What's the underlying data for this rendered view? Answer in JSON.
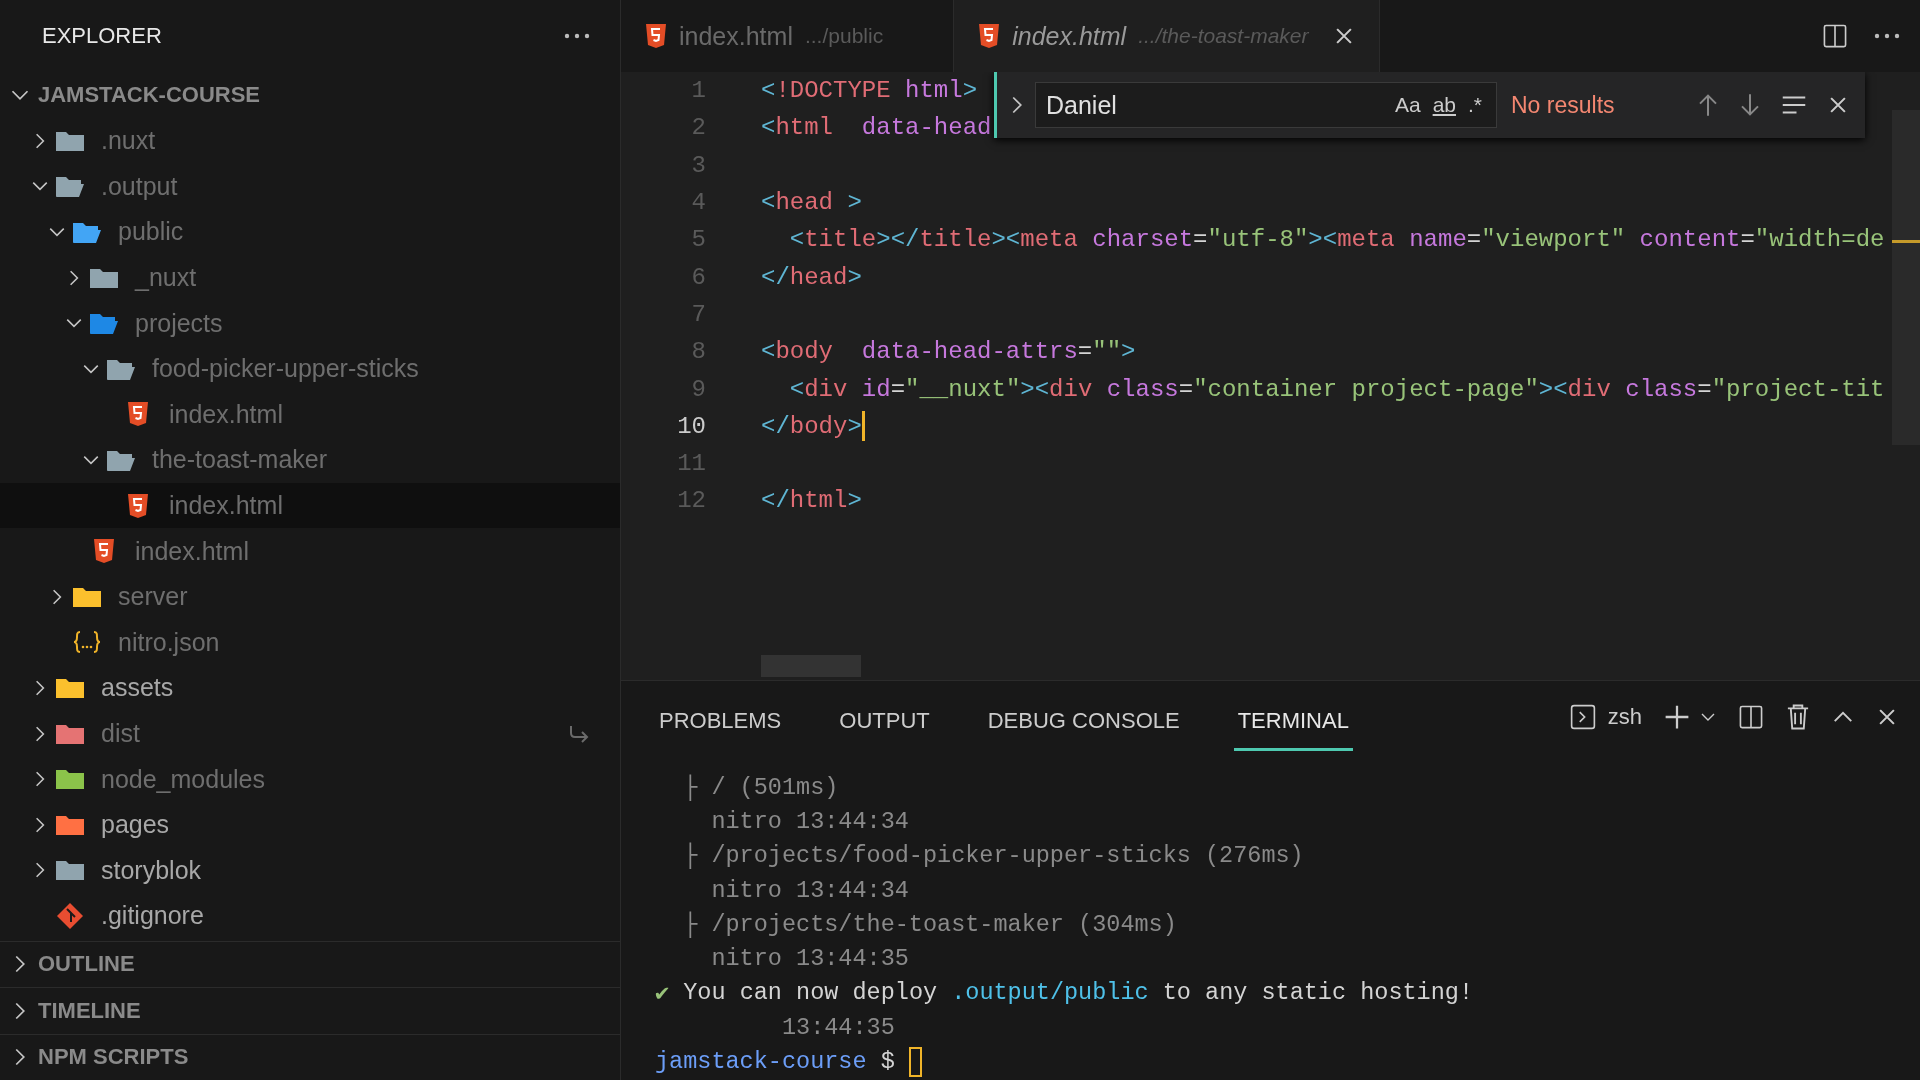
{
  "sidebar": {
    "title": "EXPLORER",
    "root": {
      "label": "JAMSTACK-COURSE",
      "expanded": true,
      "items": [
        {
          "name": ".nuxt",
          "kind": "folder",
          "color": "#90a4ae",
          "expanded": false,
          "selected": false,
          "ignored": true,
          "symlink": false
        },
        {
          "name": ".output",
          "kind": "folder",
          "color": "#90a4ae",
          "expanded": true,
          "selected": false,
          "ignored": true,
          "symlink": false,
          "children": [
            {
              "name": "public",
              "kind": "folder",
              "color": "#42a5f5",
              "expanded": true,
              "selected": false,
              "ignored": true,
              "symlink": false,
              "children": [
                {
                  "name": "_nuxt",
                  "kind": "folder",
                  "color": "#90a4ae",
                  "expanded": false,
                  "selected": false,
                  "ignored": true,
                  "symlink": false
                },
                {
                  "name": "projects",
                  "kind": "folder",
                  "color": "#1e88e5",
                  "expanded": true,
                  "selected": false,
                  "ignored": true,
                  "symlink": false,
                  "children": [
                    {
                      "name": "food-picker-upper-sticks",
                      "kind": "folder",
                      "color": "#90a4ae",
                      "expanded": true,
                      "selected": false,
                      "ignored": true,
                      "symlink": false,
                      "children": [
                        {
                          "name": "index.html",
                          "kind": "html",
                          "selected": false,
                          "ignored": true,
                          "symlink": false
                        }
                      ]
                    },
                    {
                      "name": "the-toast-maker",
                      "kind": "folder",
                      "color": "#90a4ae",
                      "expanded": true,
                      "selected": false,
                      "ignored": true,
                      "symlink": false,
                      "children": [
                        {
                          "name": "index.html",
                          "kind": "html",
                          "selected": true,
                          "ignored": true,
                          "symlink": false
                        }
                      ]
                    }
                  ]
                },
                {
                  "name": "index.html",
                  "kind": "html",
                  "selected": false,
                  "ignored": true,
                  "symlink": false
                }
              ]
            },
            {
              "name": "server",
              "kind": "folder",
              "color": "#fbc02d",
              "expanded": false,
              "selected": false,
              "ignored": true,
              "symlink": false
            },
            {
              "name": "nitro.json",
              "kind": "json",
              "selected": false,
              "ignored": true,
              "symlink": false
            }
          ]
        },
        {
          "name": "assets",
          "kind": "folder",
          "color": "#fbc02d",
          "expanded": false,
          "selected": false,
          "ignored": false,
          "symlink": false
        },
        {
          "name": "dist",
          "kind": "folder",
          "color": "#e57373",
          "expanded": false,
          "selected": false,
          "ignored": true,
          "symlink": true
        },
        {
          "name": "node_modules",
          "kind": "folder",
          "color": "#8bc34a",
          "expanded": false,
          "selected": false,
          "ignored": true,
          "symlink": false
        },
        {
          "name": "pages",
          "kind": "folder",
          "color": "#ff7043",
          "expanded": false,
          "selected": false,
          "ignored": false,
          "symlink": false
        },
        {
          "name": "storyblok",
          "kind": "folder",
          "color": "#90a4ae",
          "expanded": false,
          "selected": false,
          "ignored": false,
          "symlink": false
        },
        {
          "name": ".gitignore",
          "kind": "git",
          "selected": false,
          "ignored": false,
          "symlink": false
        }
      ]
    },
    "sections": [
      {
        "label": "OUTLINE",
        "expanded": false
      },
      {
        "label": "TIMELINE",
        "expanded": false
      },
      {
        "label": "NPM SCRIPTS",
        "expanded": false
      }
    ]
  },
  "editor": {
    "tabs": [
      {
        "label": "index.html",
        "path": ".../public",
        "selected": false,
        "preview": false
      },
      {
        "label": "index.html",
        "path": ".../the-toast-maker",
        "selected": true,
        "preview": true
      }
    ],
    "lines": [
      {
        "number": "1",
        "current": false,
        "tokens": [
          {
            "kind": "bracket",
            "text": "<"
          },
          {
            "kind": "tag",
            "text": "!DOCTYPE"
          },
          {
            "kind": "attr",
            "text": " html"
          },
          {
            "kind": "bracket",
            "text": ">"
          }
        ]
      },
      {
        "number": "2",
        "current": false,
        "tokens": [
          {
            "kind": "bracket",
            "text": "<"
          },
          {
            "kind": "tag",
            "text": "html"
          },
          {
            "kind": "attr",
            "text": "  data-head"
          }
        ]
      },
      {
        "number": "3",
        "current": false
      },
      {
        "number": "4",
        "current": false,
        "tokens": [
          {
            "kind": "bracket",
            "text": "<"
          },
          {
            "kind": "tag",
            "text": "head"
          },
          {
            "kind": "bracket",
            "text": " >"
          }
        ]
      },
      {
        "number": "5",
        "current": false,
        "tokens": [
          {
            "kind": "bracket",
            "text": "  <"
          },
          {
            "kind": "tag",
            "text": "title"
          },
          {
            "kind": "bracket",
            "text": "></"
          },
          {
            "kind": "tag",
            "text": "title"
          },
          {
            "kind": "bracket",
            "text": "><"
          },
          {
            "kind": "tag",
            "text": "meta"
          },
          {
            "kind": "attr",
            "text": " charset"
          },
          {
            "kind": "plain",
            "text": "="
          },
          {
            "kind": "string",
            "text": "\"utf-8\""
          },
          {
            "kind": "bracket",
            "text": "><"
          },
          {
            "kind": "tag",
            "text": "meta"
          },
          {
            "kind": "attr",
            "text": " name"
          },
          {
            "kind": "plain",
            "text": "="
          },
          {
            "kind": "string",
            "text": "\"viewport\""
          },
          {
            "kind": "attr",
            "text": " content"
          },
          {
            "kind": "plain",
            "text": "="
          },
          {
            "kind": "string",
            "text": "\"width=de"
          }
        ]
      },
      {
        "number": "6",
        "current": false,
        "tokens": [
          {
            "kind": "bracket",
            "text": "</"
          },
          {
            "kind": "tag",
            "text": "head"
          },
          {
            "kind": "bracket",
            "text": ">"
          }
        ]
      },
      {
        "number": "7",
        "current": false
      },
      {
        "number": "8",
        "current": false,
        "tokens": [
          {
            "kind": "bracket",
            "text": "<"
          },
          {
            "kind": "tag",
            "text": "body"
          },
          {
            "kind": "attr",
            "text": "  data-head-attrs"
          },
          {
            "kind": "plain",
            "text": "="
          },
          {
            "kind": "string",
            "text": "\"\""
          },
          {
            "kind": "bracket",
            "text": ">"
          }
        ]
      },
      {
        "number": "9",
        "current": false,
        "tokens": [
          {
            "kind": "bracket",
            "text": "  <"
          },
          {
            "kind": "tag",
            "text": "div"
          },
          {
            "kind": "attr",
            "text": " id"
          },
          {
            "kind": "plain",
            "text": "="
          },
          {
            "kind": "string",
            "text": "\"__nuxt\""
          },
          {
            "kind": "bracket",
            "text": "><"
          },
          {
            "kind": "tag",
            "text": "div"
          },
          {
            "kind": "attr",
            "text": " class"
          },
          {
            "kind": "plain",
            "text": "="
          },
          {
            "kind": "string",
            "text": "\"container project-page\""
          },
          {
            "kind": "bracket",
            "text": "><"
          },
          {
            "kind": "tag",
            "text": "div"
          },
          {
            "kind": "attr",
            "text": " class"
          },
          {
            "kind": "plain",
            "text": "="
          },
          {
            "kind": "string",
            "text": "\"project-tit"
          }
        ]
      },
      {
        "number": "10",
        "current": true,
        "tokens": [
          {
            "kind": "bracket",
            "text": "</"
          },
          {
            "kind": "tag",
            "text": "body"
          },
          {
            "kind": "bracket",
            "text": ">"
          }
        ]
      },
      {
        "number": "11",
        "current": false
      },
      {
        "number": "12",
        "current": false,
        "tokens": [
          {
            "kind": "bracket",
            "text": "</"
          },
          {
            "kind": "tag",
            "text": "html"
          },
          {
            "kind": "bracket",
            "text": ">"
          }
        ]
      }
    ],
    "find": {
      "value": "Daniel",
      "toggles": [
        "Aa",
        "ab",
        ".*"
      ],
      "result": "No results"
    }
  },
  "panel": {
    "tabs": [
      {
        "label": "PROBLEMS",
        "selected": false
      },
      {
        "label": "OUTPUT",
        "selected": false
      },
      {
        "label": "DEBUG CONSOLE",
        "selected": false
      },
      {
        "label": "TERMINAL",
        "selected": true
      }
    ],
    "shell": "zsh",
    "terminal": [
      [
        {
          "kind": "dim",
          "text": "  ├ / (501ms)"
        }
      ],
      [
        {
          "kind": "dim",
          "text": "    nitro 13:44:34"
        }
      ],
      [
        {
          "kind": "dim",
          "text": "  ├ /projects/food-picker-upper-sticks (276ms)"
        }
      ],
      [
        {
          "kind": "dim",
          "text": "    nitro 13:44:34"
        }
      ],
      [
        {
          "kind": "dim",
          "text": "  ├ /projects/the-toast-maker (304ms)"
        }
      ],
      [
        {
          "kind": "dim",
          "text": "    nitro 13:44:35"
        }
      ],
      [
        {
          "kind": "success",
          "text": "✔"
        },
        {
          "kind": "text",
          "text": " You can now deploy "
        },
        {
          "kind": "link",
          "text": ".output/public"
        },
        {
          "kind": "text",
          "text": " to any static hosting!"
        }
      ],
      [
        {
          "kind": "dim",
          "text": "         13:44:35"
        }
      ],
      [
        {
          "kind": "prompt",
          "text": "jamstack-course"
        },
        {
          "kind": "text",
          "text": " $ "
        },
        {
          "kind": "cursor"
        }
      ]
    ]
  }
}
